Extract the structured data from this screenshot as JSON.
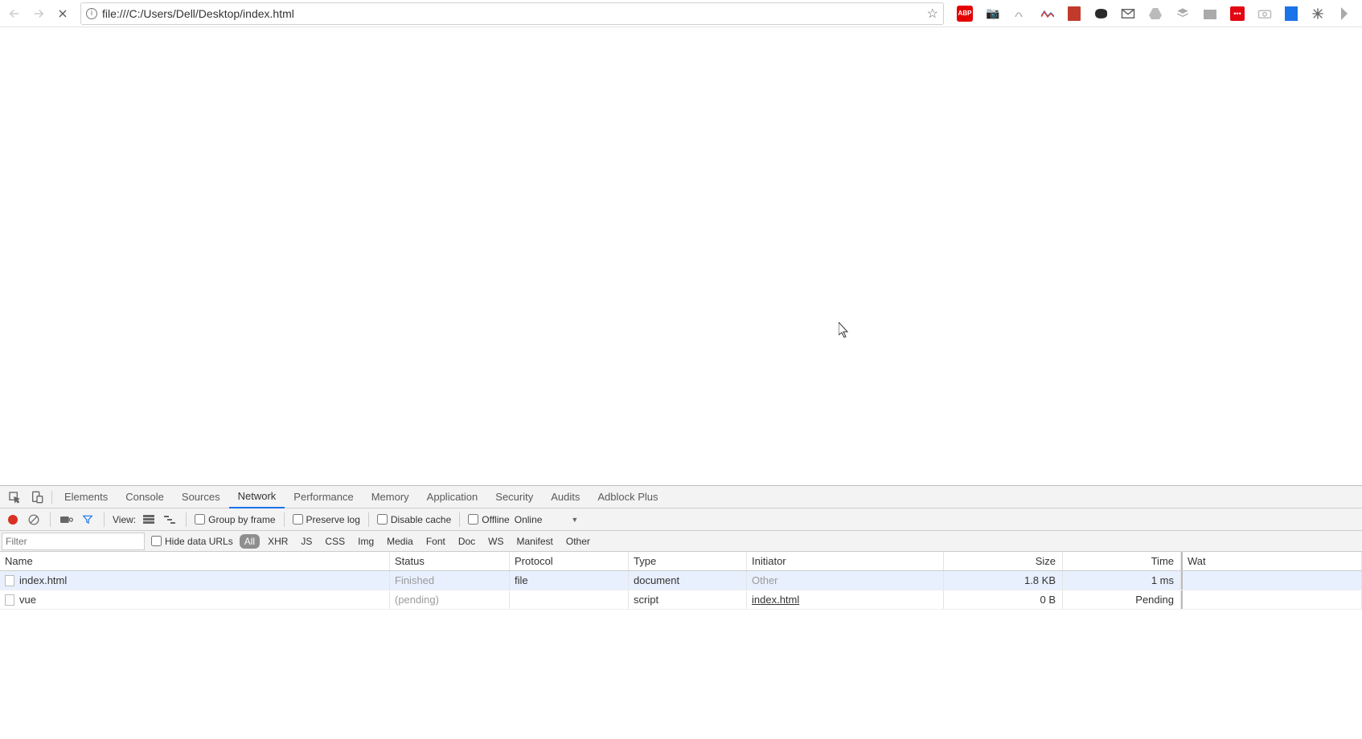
{
  "nav": {
    "url": "file:///C:/Users/Dell/Desktop/index.html"
  },
  "devtools": {
    "tabs": [
      "Elements",
      "Console",
      "Sources",
      "Network",
      "Performance",
      "Memory",
      "Application",
      "Security",
      "Audits",
      "Adblock Plus"
    ],
    "activeTab": "Network",
    "toolbar": {
      "view_label": "View:",
      "group_by_frame": "Group by frame",
      "preserve_log": "Preserve log",
      "disable_cache": "Disable cache",
      "offline": "Offline",
      "online": "Online"
    },
    "filter": {
      "placeholder": "Filter",
      "hide_data_urls": "Hide data URLs",
      "chips": [
        "All",
        "XHR",
        "JS",
        "CSS",
        "Img",
        "Media",
        "Font",
        "Doc",
        "WS",
        "Manifest",
        "Other"
      ],
      "activeChip": "All"
    },
    "columns": {
      "name": "Name",
      "status": "Status",
      "protocol": "Protocol",
      "type": "Type",
      "initiator": "Initiator",
      "size": "Size",
      "time": "Time",
      "wat": "Wat"
    },
    "rows": [
      {
        "name": "index.html",
        "status": "Finished",
        "status_muted": true,
        "protocol": "file",
        "type": "document",
        "initiator": "Other",
        "initiator_muted": true,
        "initiator_underline": false,
        "size": "1.8 KB",
        "time": "1 ms",
        "selected": true
      },
      {
        "name": "vue",
        "status": "(pending)",
        "status_muted": true,
        "protocol": "",
        "type": "script",
        "initiator": "index.html",
        "initiator_muted": false,
        "initiator_underline": true,
        "size": "0 B",
        "time": "Pending",
        "selected": false
      }
    ]
  }
}
